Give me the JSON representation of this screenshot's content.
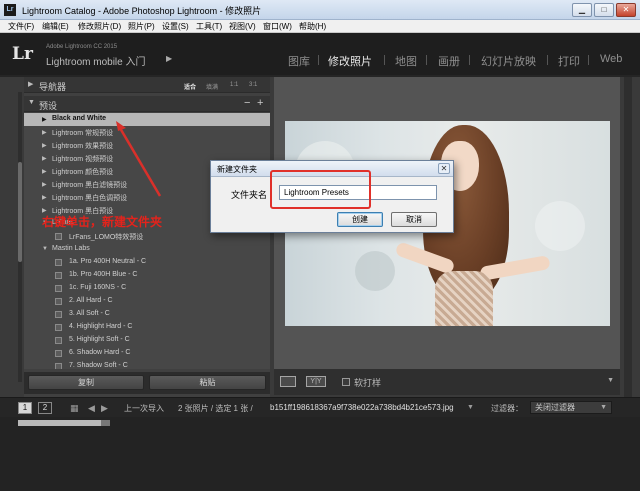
{
  "window": {
    "title": "Lightroom Catalog - Adobe Photoshop Lightroom - 修改照片",
    "app_icon": "Lr",
    "controls": [
      "minimize-icon",
      "maximize-icon",
      "close-icon"
    ],
    "min_glyph": "▁",
    "max_glyph": "□",
    "close_glyph": "✕"
  },
  "menu": {
    "items": [
      "文件(F)",
      "编辑(E)",
      "修改照片(D)",
      "照片(P)",
      "设置(S)",
      "工具(T)",
      "视图(V)",
      "窗口(W)",
      "帮助(H)"
    ]
  },
  "header": {
    "logo": "Lr",
    "version": "Adobe Lightroom CC 2015",
    "user_text": "Lightroom mobile 入门",
    "arrow": "▶",
    "modules": [
      "图库",
      "修改照片",
      "地图",
      "画册",
      "幻灯片放映",
      "打印",
      "Web"
    ],
    "active_module": "修改照片"
  },
  "navigator": {
    "label": "导航器",
    "tri": "▶",
    "options": [
      "适合",
      "填满",
      "1:1",
      "3:1"
    ],
    "selected": "适合"
  },
  "presets": {
    "label": "预设",
    "tri": "▼",
    "minus": "−",
    "plus": "+",
    "items": [
      {
        "name": "Black and White",
        "expanded": false,
        "selected": true
      },
      {
        "name": "Lightroom 常规预设",
        "expanded": false
      },
      {
        "name": "Lightroom 效果预设",
        "expanded": false
      },
      {
        "name": "Lightroom 视频预设",
        "expanded": false
      },
      {
        "name": "Lightroom 颜色预设",
        "expanded": false
      },
      {
        "name": "Lightroom 黑白滤镜预设",
        "expanded": false
      },
      {
        "name": "Lightroom 黑白色调预设",
        "expanded": false
      },
      {
        "name": "Lightroom 黑白预设",
        "expanded": false
      },
      {
        "name": "LrFans",
        "expanded": true
      },
      {
        "name": "LrFans_LOMO特效预设",
        "child": true
      },
      {
        "name": "Mastin Labs",
        "expanded": true
      },
      {
        "name": "1a. Pro 400H Neutral - C",
        "child": true
      },
      {
        "name": "1b. Pro 400H Blue - C",
        "child": true
      },
      {
        "name": "1c. Fuji 160NS - C",
        "child": true
      },
      {
        "name": "2. All Hard - C",
        "child": true
      },
      {
        "name": "3. All Soft - C",
        "child": true
      },
      {
        "name": "4. Highlight Hard - C",
        "child": true
      },
      {
        "name": "5. Highlight Soft - C",
        "child": true
      },
      {
        "name": "6. Shadow Hard - C",
        "child": true
      },
      {
        "name": "7. Shadow Soft - C",
        "child": true
      }
    ]
  },
  "left_footer": {
    "copy_label": "复制",
    "paste_label": "粘贴"
  },
  "center_toolbar": {
    "yy_label": "Y|Y",
    "soft_proof_label": "软打样",
    "drop_glyph": "▼"
  },
  "filmstrip": {
    "page1": "1",
    "page2": "2",
    "grid_glyph": "▦",
    "back_glyph": "◀",
    "forward_glyph": "▶",
    "source_text": "上一次导入",
    "count_text": "2 张照片 / 选定 1 张 /",
    "filename": "b151ff198618367a9f738e022a738bd4b21ce573.jpg",
    "dropdown_glyph": "▼",
    "filter_label": "过滤器：",
    "filter_value": "关闭过滤器",
    "progress": 0.9
  },
  "dialog": {
    "title": "新建文件夹",
    "close_glyph": "✕",
    "field_label": "文件夹名",
    "field_value": "Lightroom Presets",
    "create_label": "创建",
    "cancel_label": "取消"
  },
  "annotation": {
    "text": "右键单击，新建文件夹",
    "color": "#e3231c"
  },
  "colors": {
    "panel_bg": "#404040",
    "selection": "#b7b7b7",
    "header_bg": "#1e1e1e",
    "annotation_red": "#e0302a"
  }
}
